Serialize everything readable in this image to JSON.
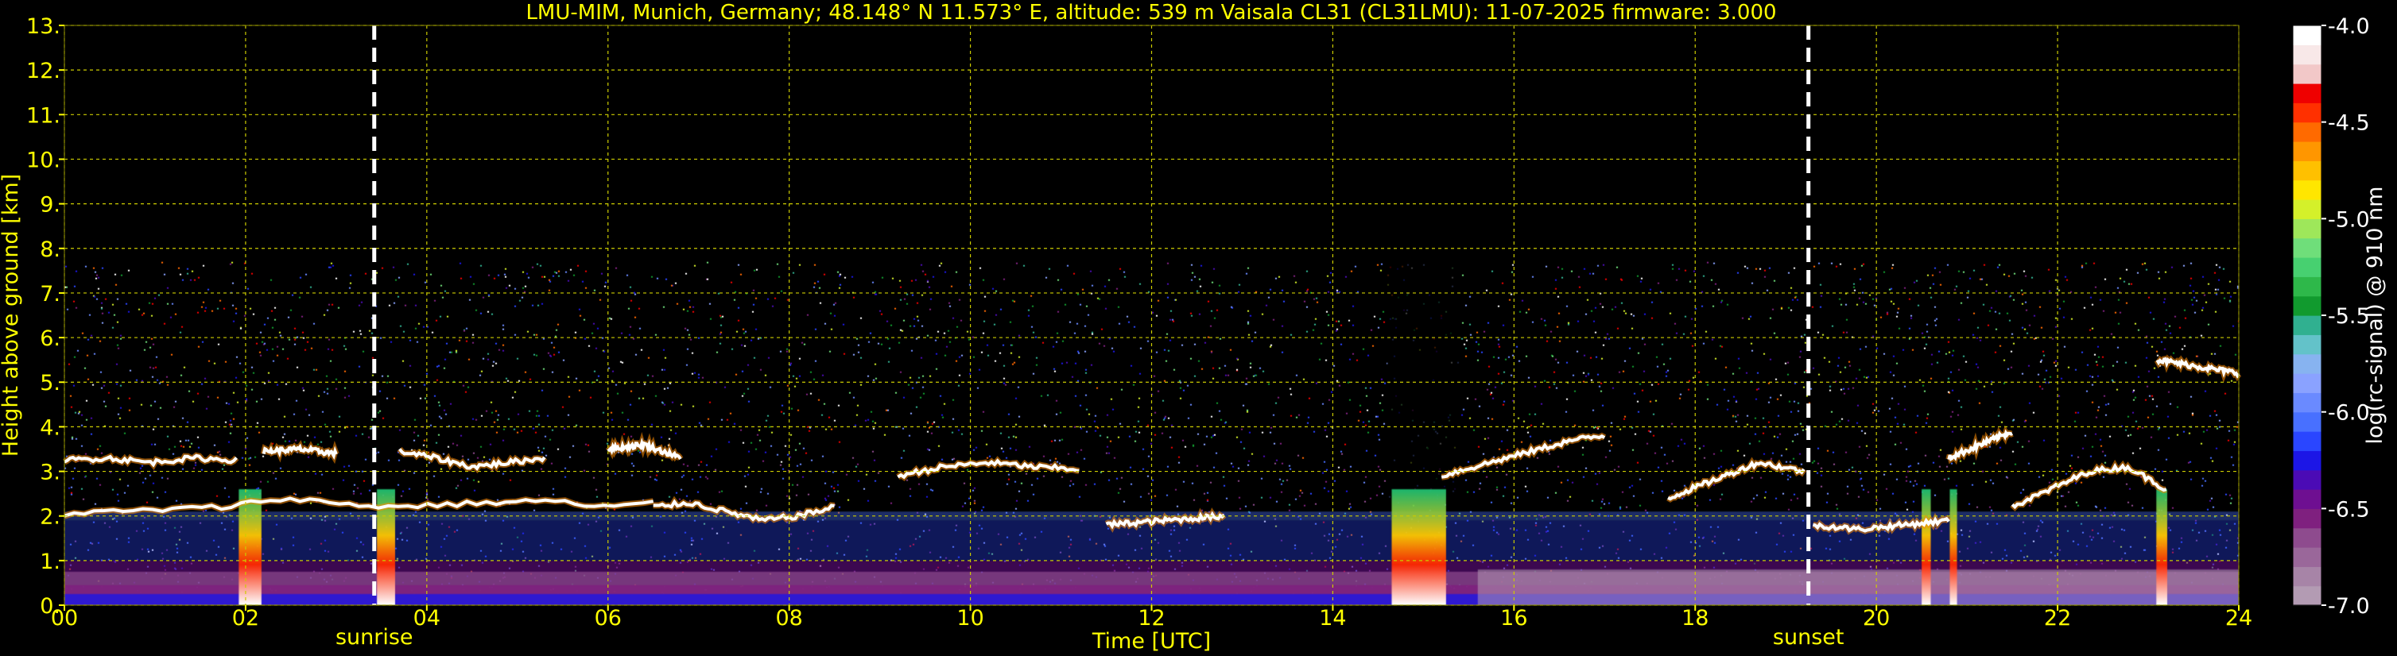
{
  "chart_data": {
    "type": "heatmap",
    "title": "LMU-MIM, Munich, Germany; 48.148° N 11.573° E, altitude: 539 m    Vaisala CL31 (CL31LMU): 11-07-2025    firmware: 3.000",
    "xlabel": "Time [UTC]",
    "ylabel": "Height above ground [km]",
    "xlim": [
      0,
      24
    ],
    "ylim": [
      0,
      13
    ],
    "x_ticks": [
      "00",
      "02",
      "04",
      "06",
      "08",
      "10",
      "12",
      "14",
      "16",
      "18",
      "20",
      "22",
      "24"
    ],
    "y_ticks": [
      "0.",
      "1.",
      "2.",
      "3.",
      "4.",
      "5.",
      "6.",
      "7.",
      "8.",
      "9.",
      "10.",
      "11.",
      "12.",
      "13."
    ],
    "grid": true,
    "grid_color": "#cccc00",
    "signal_top_km": 7.7,
    "annotations": [
      {
        "label": "sunrise",
        "time": 3.42
      },
      {
        "label": "sunset",
        "time": 19.25
      }
    ],
    "colorbar": {
      "label": "log(rc-signal) @ 910 nm",
      "range": [
        -7.0,
        -4.0
      ],
      "ticks": [
        "-7.0",
        "-6.5",
        "-6.0",
        "-5.5",
        "-5.0",
        "-4.5",
        "-4.0"
      ],
      "colors": [
        "#b39bb3",
        "#a784a7",
        "#9a679a",
        "#8e4b8e",
        "#7f207f",
        "#6e0f91",
        "#4b0bb5",
        "#1c16e6",
        "#2a46ff",
        "#4870ff",
        "#6a8aff",
        "#8aa2ff",
        "#87b3f0",
        "#63c2c9",
        "#30b090",
        "#119a2e",
        "#2eb84a",
        "#47d070",
        "#6fde7a",
        "#9ee75a",
        "#d4f02a",
        "#ffe600",
        "#ffc000",
        "#ff9600",
        "#ff6a00",
        "#ff3000",
        "#ef0000",
        "#f2c8c8",
        "#f8e8e8",
        "#ffffff"
      ]
    },
    "cloud_layers": [
      {
        "t0": 0.0,
        "t1": 1.9,
        "h": [
          3.25,
          3.3,
          3.2,
          3.3,
          3.25
        ]
      },
      {
        "t0": 2.2,
        "t1": 3.0,
        "h": [
          3.45,
          3.5,
          3.4
        ]
      },
      {
        "t0": 3.7,
        "t1": 5.3,
        "h": [
          3.45,
          3.3,
          3.1,
          3.2,
          3.3
        ]
      },
      {
        "t0": 6.0,
        "t1": 6.8,
        "h": [
          3.5,
          3.6,
          3.3
        ]
      },
      {
        "t0": 0.0,
        "t1": 6.5,
        "h": [
          2.05,
          2.1,
          2.15,
          2.2,
          2.4,
          2.3,
          2.2,
          2.25,
          2.3,
          2.35,
          2.2,
          2.3
        ]
      },
      {
        "t0": 6.5,
        "t1": 8.5,
        "h": [
          2.2,
          2.3,
          2.1,
          1.9,
          2.0,
          2.2
        ]
      },
      {
        "t0": 9.2,
        "t1": 11.2,
        "h": [
          2.9,
          3.1,
          3.2,
          3.1,
          3.05
        ]
      },
      {
        "t0": 11.5,
        "t1": 12.8,
        "h": [
          1.8,
          1.9,
          2.0
        ]
      },
      {
        "t0": 15.2,
        "t1": 17.0,
        "h": [
          2.9,
          3.1,
          3.3,
          3.5,
          3.7,
          3.8
        ]
      },
      {
        "t0": 17.7,
        "t1": 19.2,
        "h": [
          2.4,
          2.8,
          3.2,
          3.0
        ]
      },
      {
        "t0": 19.3,
        "t1": 20.8,
        "h": [
          1.8,
          1.7,
          1.8,
          1.9
        ]
      },
      {
        "t0": 20.8,
        "t1": 21.5,
        "h": [
          3.3,
          3.6,
          3.9
        ]
      },
      {
        "t0": 21.5,
        "t1": 23.2,
        "h": [
          2.2,
          2.6,
          3.0,
          3.1,
          2.6
        ]
      },
      {
        "t0": 23.1,
        "t1": 24.0,
        "h": [
          5.5,
          5.4,
          5.3,
          5.2
        ]
      }
    ],
    "precip_columns": [
      {
        "t": 2.05,
        "width": 0.25
      },
      {
        "t": 3.55,
        "width": 0.2
      },
      {
        "t": 14.95,
        "width": 0.6
      },
      {
        "t": 20.55,
        "width": 0.1
      },
      {
        "t": 20.85,
        "width": 0.08
      },
      {
        "t": 23.15,
        "width": 0.12
      }
    ]
  }
}
